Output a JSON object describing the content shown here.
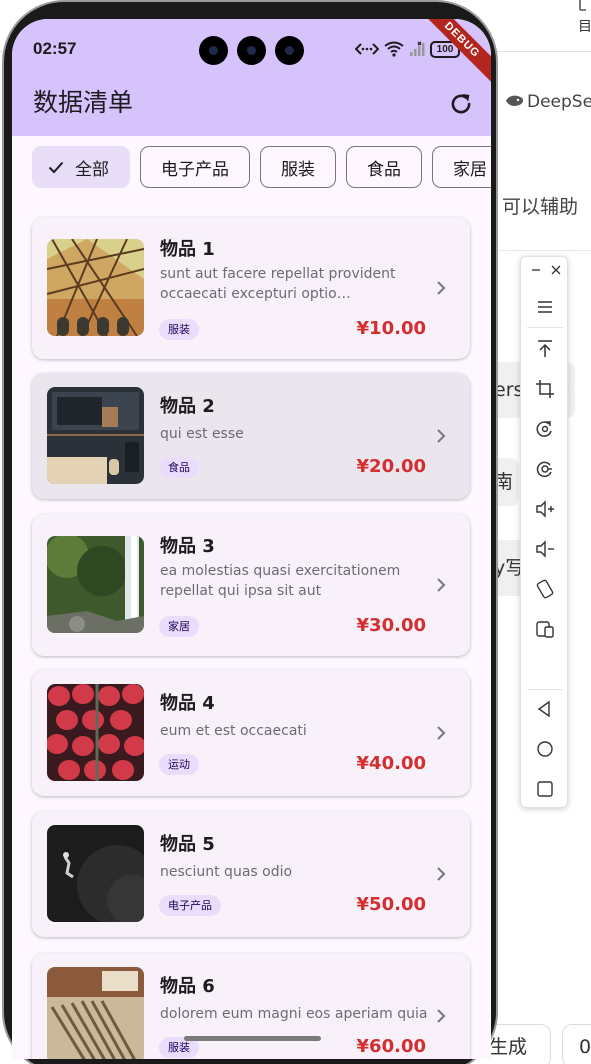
{
  "background": {
    "tab_label": "目",
    "deepseek_label": "DeepSe",
    "assist_text": "可以辅助",
    "pills": [
      "ers)讨论",
      "南",
      "y写"
    ],
    "bottom_chips": [
      "码生成",
      "0"
    ]
  },
  "status_bar": {
    "time": "02:57",
    "battery": "100"
  },
  "debug_banner": "DEBUG",
  "app": {
    "title": "数据清单",
    "refresh_icon": "refresh-icon"
  },
  "filters": [
    {
      "label": "全部",
      "selected": true
    },
    {
      "label": "电子产品",
      "selected": false
    },
    {
      "label": "服装",
      "selected": false
    },
    {
      "label": "食品",
      "selected": false
    },
    {
      "label": "家居",
      "selected": false
    }
  ],
  "items": [
    {
      "title": "物品 1",
      "description": "sunt aut facere repellat provident occaecati excepturi optio reprehenderit",
      "category": "服装",
      "price": "¥10.00",
      "image": "architecture-photo"
    },
    {
      "title": "物品 2",
      "description": "qui est esse",
      "category": "食品",
      "price": "¥20.00",
      "image": "desk-workspace-photo"
    },
    {
      "title": "物品 3",
      "description": "ea molestias quasi exercitationem repellat qui ipsa sit aut",
      "category": "家居",
      "price": "¥30.00",
      "image": "waterfall-photo"
    },
    {
      "title": "物品 4",
      "description": "eum et est occaecati",
      "category": "运动",
      "price": "¥40.00",
      "image": "strawberries-photo"
    },
    {
      "title": "物品 5",
      "description": "nesciunt quas odio",
      "category": "电子产品",
      "price": "¥50.00",
      "image": "diver-photo"
    },
    {
      "title": "物品 6",
      "description": "dolorem eum magni eos aperiam quia",
      "category": "服装",
      "price": "¥60.00",
      "image": "tools-photo"
    }
  ],
  "toolbar_icons": [
    "minimize-icon",
    "close-icon",
    "menu-icon",
    "pin-top-icon",
    "crop-icon",
    "rotate-icon",
    "screenshot-icon",
    "volume-up-icon",
    "volume-down-icon",
    "rotate-screen-icon",
    "multi-window-icon",
    "back-icon",
    "home-icon",
    "recents-icon"
  ],
  "colors": {
    "app_bar": "#d6c3fb",
    "price": "#d32f2f",
    "tag_bg": "#eaddfc",
    "chip_selected": "#e8def8"
  }
}
